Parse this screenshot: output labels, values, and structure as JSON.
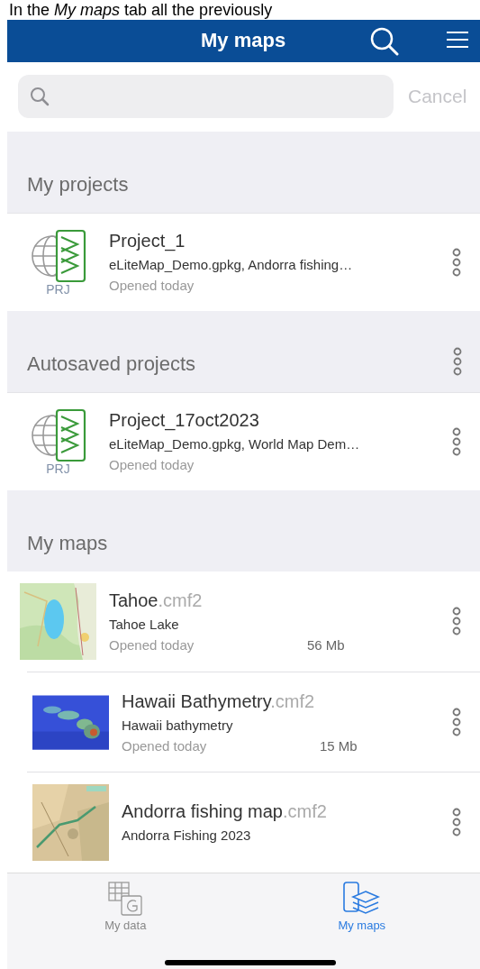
{
  "caption": "In the *My maps* tab all the previously",
  "header": {
    "title": "My maps"
  },
  "search": {
    "cancel": "Cancel"
  },
  "sections": [
    {
      "title": "My projects",
      "has_menu": false,
      "items": [
        {
          "kind": "project",
          "name": "Project_1",
          "detail": "eLiteMap_Demo.gpkg, Andorra fishing…",
          "opened": "Opened today",
          "badge": "PRJ"
        }
      ]
    },
    {
      "title": "Autosaved projects",
      "has_menu": true,
      "items": [
        {
          "kind": "project",
          "name": "Project_17oct2023",
          "detail": "eLiteMap_Demo.gpkg, World Map Dem…",
          "opened": "Opened today",
          "badge": "PRJ"
        }
      ]
    },
    {
      "title": "My maps",
      "has_menu": false,
      "items": [
        {
          "kind": "map",
          "name": "Tahoe",
          "ext": ".cmf2",
          "detail": "Tahoe Lake",
          "opened": "Opened today",
          "size": "56 Mb"
        },
        {
          "kind": "map",
          "name": "Hawaii Bathymetry",
          "ext": ".cmf2",
          "detail": "Hawaii bathymetry",
          "opened": "Opened today",
          "size": "15 Mb"
        },
        {
          "kind": "map",
          "name": "Andorra fishing map",
          "ext": ".cmf2",
          "detail": "Andorra Fishing 2023"
        }
      ]
    }
  ],
  "tabs": [
    {
      "label": "My data",
      "selected": false
    },
    {
      "label": "My maps",
      "selected": true
    }
  ]
}
